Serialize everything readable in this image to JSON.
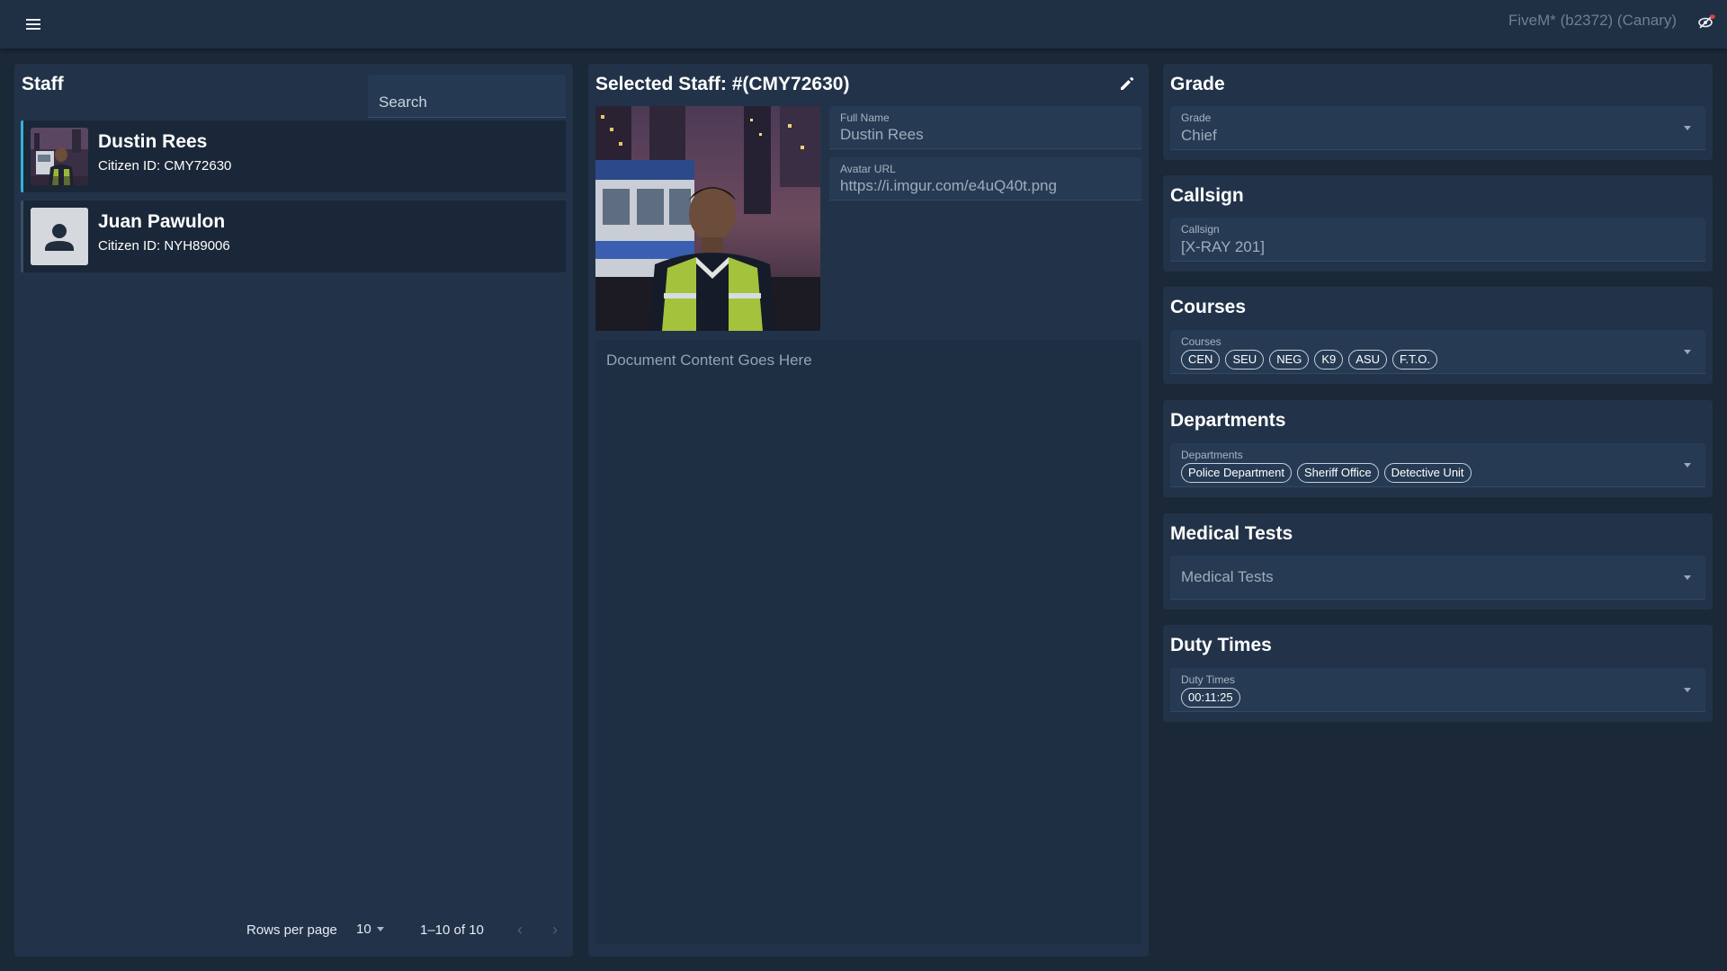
{
  "topbar": {
    "window_title": "FiveM* (b2372) (Canary)"
  },
  "staff_panel": {
    "title": "Staff",
    "search_placeholder": "Search",
    "items": [
      {
        "name": "Dustin Rees",
        "citizen_id": "Citizen ID: CMY72630"
      },
      {
        "name": "Juan Pawulon",
        "citizen_id": "Citizen ID: NYH89006"
      }
    ],
    "pagination": {
      "rows_per_page_label": "Rows per page",
      "rows_per_page_value": "10",
      "range": "1–10 of 10"
    }
  },
  "selected_panel": {
    "title": "Selected Staff: #(CMY72630)",
    "full_name_label": "Full Name",
    "full_name_value": "Dustin Rees",
    "avatar_url_label": "Avatar URL",
    "avatar_url_value": "https://i.imgur.com/e4uQ40t.png",
    "document_placeholder": "Document Content Goes Here"
  },
  "grade_card": {
    "title": "Grade",
    "field_label": "Grade",
    "value": "Chief"
  },
  "callsign_card": {
    "title": "Callsign",
    "field_label": "Callsign",
    "value": "[X-RAY 201]"
  },
  "courses_card": {
    "title": "Courses",
    "field_label": "Courses",
    "chips": [
      "CEN",
      "SEU",
      "NEG",
      "K9",
      "ASU",
      "F.T.O."
    ]
  },
  "departments_card": {
    "title": "Departments",
    "field_label": "Departments",
    "chips": [
      "Police Department",
      "Sheriff Office",
      "Detective Unit"
    ]
  },
  "medical_card": {
    "title": "Medical Tests",
    "placeholder": "Medical Tests"
  },
  "duty_card": {
    "title": "Duty Times",
    "field_label": "Duty Times",
    "chips": [
      "00:11:25"
    ]
  },
  "colors": {
    "background": "#1b2838",
    "panel": "#223349",
    "accent": "#35b0d6"
  }
}
